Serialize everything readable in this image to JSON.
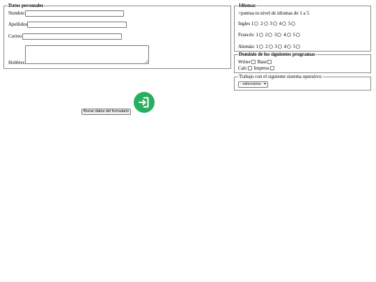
{
  "datos": {
    "legend": "Datos personales",
    "nombre_label": "Nombre",
    "apellidos_label": "Apellidos",
    "correo_label": "Correo",
    "hobbies_label": "Hobbies"
  },
  "idiomas": {
    "legend": "Idiomas",
    "intro": ">puntua tu nivel de idiomas de 1 a 5",
    "rows": [
      {
        "label": "Ingles",
        "options": [
          "1",
          "2",
          "3",
          "4",
          "5"
        ]
      },
      {
        "label": "Francés:",
        "options": [
          "1",
          "2",
          "3",
          "4",
          "5"
        ]
      },
      {
        "label": "Alemán:",
        "options": [
          "1",
          "2",
          "3",
          "4",
          "5"
        ]
      }
    ]
  },
  "dominio": {
    "legend": "Dominio de los siguientes programas",
    "items": [
      "Writer",
      "Base",
      "Calc",
      "Impress"
    ]
  },
  "sistema": {
    "legend": "Trabajo con el siguiente sistema operativo:",
    "select_value": "- selecciona -"
  },
  "actions": {
    "reset_label": "Borrar datos del formulario",
    "fab_icon": "login-icon",
    "fab_color": "#27ae60"
  }
}
